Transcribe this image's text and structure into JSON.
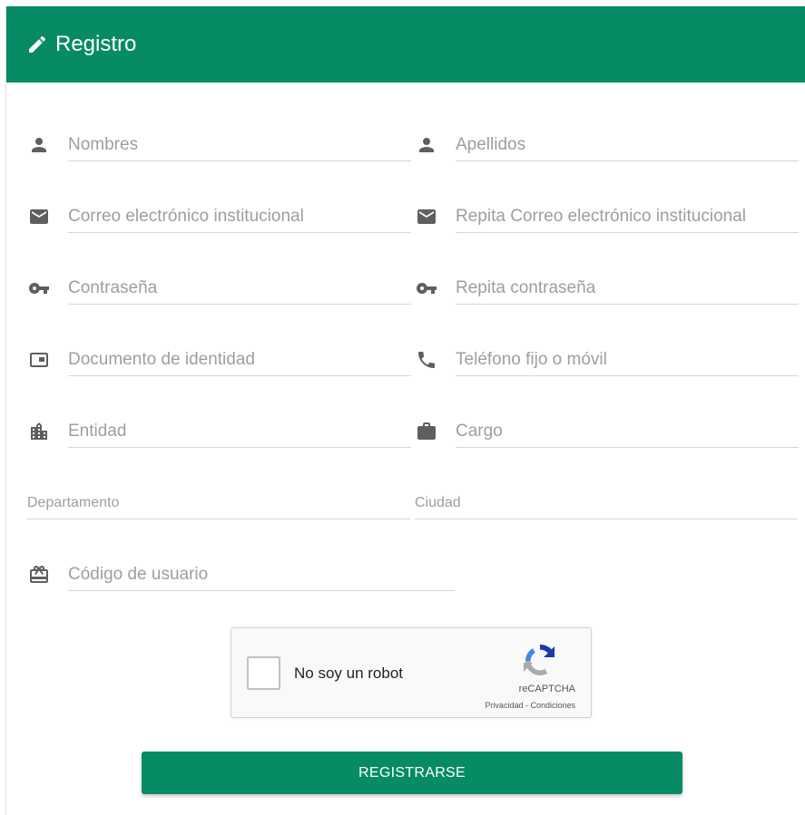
{
  "header": {
    "title": "Registro",
    "icon": "pencil-icon"
  },
  "form": {
    "nombres": {
      "placeholder": "Nombres",
      "icon": "person-icon"
    },
    "apellidos": {
      "placeholder": "Apellidos",
      "icon": "person-icon"
    },
    "correo": {
      "placeholder": "Correo electrónico institucional",
      "icon": "email-icon"
    },
    "repita_correo": {
      "placeholder": "Repita Correo electrónico institucional",
      "icon": "email-icon"
    },
    "contrasena": {
      "placeholder": "Contraseña",
      "icon": "key-icon"
    },
    "repita_contrasena": {
      "placeholder": "Repita contraseña",
      "icon": "key-icon"
    },
    "documento": {
      "placeholder": "Documento de identidad",
      "icon": "id-card-icon"
    },
    "telefono": {
      "placeholder": "Teléfono fijo o móvil",
      "icon": "phone-icon"
    },
    "entidad": {
      "placeholder": "Entidad",
      "icon": "building-icon"
    },
    "cargo": {
      "placeholder": "Cargo",
      "icon": "briefcase-icon"
    },
    "departamento": {
      "placeholder": "Departamento"
    },
    "ciudad": {
      "placeholder": "Ciudad"
    },
    "codigo_usuario": {
      "placeholder": "Código de usuario",
      "icon": "card-giftcard-icon"
    }
  },
  "captcha": {
    "label": "No soy un robot",
    "brand": "reCAPTCHA",
    "privacy": "Privacidad",
    "separator": " - ",
    "terms": "Condiciones"
  },
  "submit": {
    "label": "REGISTRARSE"
  },
  "colors": {
    "primary": "#078b64",
    "icon": "#5f5f5f",
    "placeholder": "#9e9e9e",
    "underline": "#d6d6d6"
  }
}
